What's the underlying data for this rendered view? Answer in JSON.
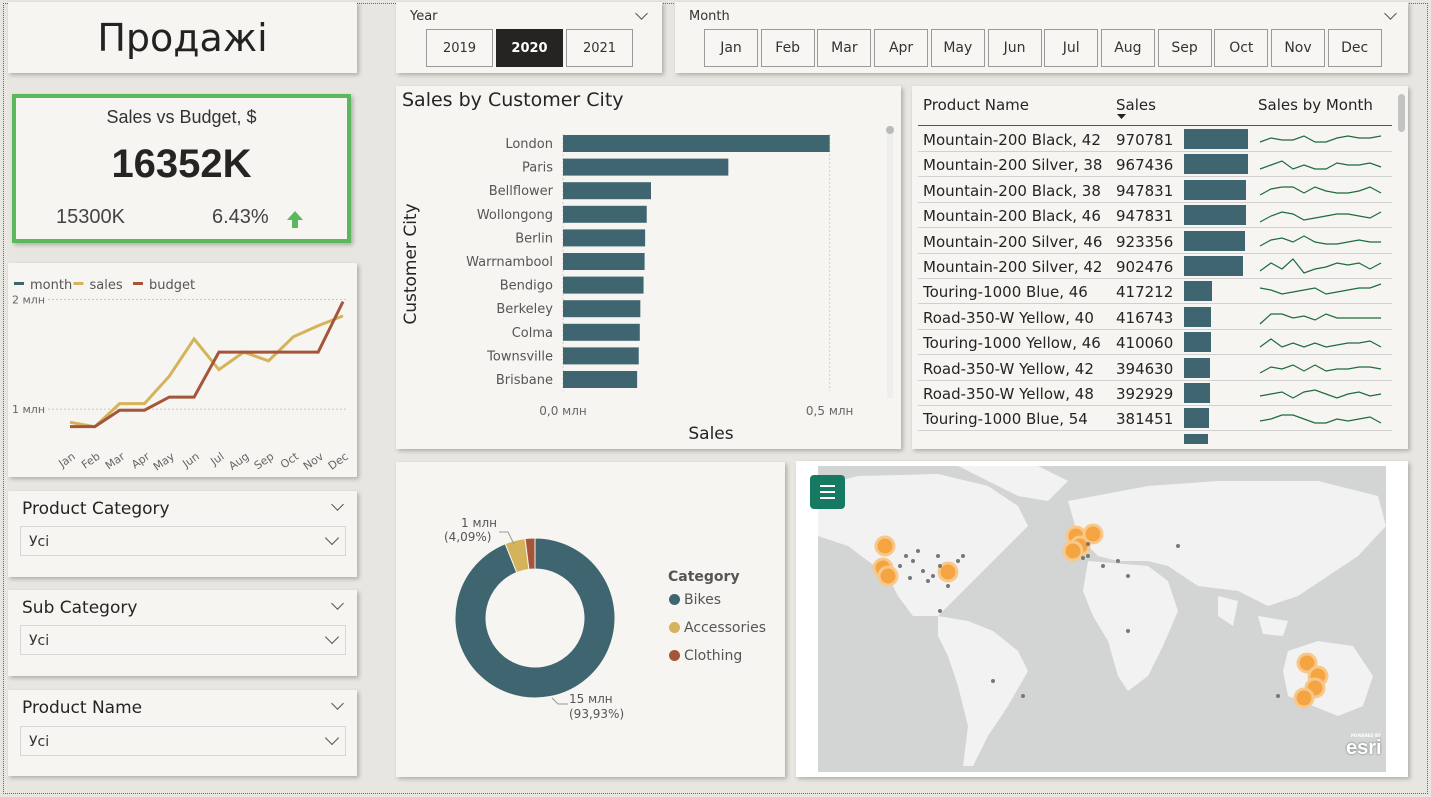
{
  "page": {
    "title": "Продажі"
  },
  "year_slicer": {
    "label": "Year",
    "options": [
      "2019",
      "2020",
      "2021"
    ],
    "selected": "2020"
  },
  "month_slicer": {
    "label": "Month",
    "options": [
      "Jan",
      "Feb",
      "Mar",
      "Apr",
      "May",
      "Jun",
      "Jul",
      "Aug",
      "Sep",
      "Oct",
      "Nov",
      "Dec"
    ]
  },
  "kpi": {
    "title": "Sales vs Budget, $",
    "value": "16352K",
    "budget": "15300K",
    "percent": "6.43%",
    "trend": "up",
    "color": "#5cb85c"
  },
  "line_chart": {
    "legend": [
      "month",
      "sales",
      "budget"
    ],
    "y_ticks": [
      "2 млн",
      "1 млн"
    ],
    "chart_data": {
      "type": "line",
      "categories": [
        "Jan",
        "Feb",
        "Mar",
        "Apr",
        "May",
        "Jun",
        "Jul",
        "Aug",
        "Sep",
        "Oct",
        "Nov",
        "Dec"
      ],
      "series": [
        {
          "name": "sales",
          "color": "#d4b35a",
          "values": [
            0.88,
            0.84,
            1.05,
            1.05,
            1.3,
            1.64,
            1.36,
            1.52,
            1.44,
            1.66,
            1.76,
            1.85
          ]
        },
        {
          "name": "budget",
          "color": "#a4553a",
          "values": [
            0.84,
            0.84,
            0.99,
            0.99,
            1.11,
            1.11,
            1.52,
            1.52,
            1.52,
            1.52,
            1.52,
            1.98
          ]
        }
      ],
      "ylim": [
        0.6,
        2.15
      ]
    }
  },
  "filters": [
    {
      "title": "Product Category",
      "value": "Усі"
    },
    {
      "title": "Sub Category",
      "value": "Усі"
    },
    {
      "title": "Product Name",
      "value": "Усі"
    }
  ],
  "city_chart": {
    "title": "Sales by Customer City",
    "chart_data": {
      "type": "bar",
      "orientation": "horizontal",
      "categories": [
        "London",
        "Paris",
        "Bellflower",
        "Wollongong",
        "Berlin",
        "Warrnambool",
        "Bendigo",
        "Berkeley",
        "Colma",
        "Townsville",
        "Brisbane"
      ],
      "values": [
        0.5,
        0.31,
        0.165,
        0.157,
        0.154,
        0.153,
        0.151,
        0.145,
        0.144,
        0.142,
        0.139
      ],
      "xlabel": "Sales",
      "ylabel": "Customer City",
      "x_ticks": [
        "0,0 млн",
        "0,5 млн"
      ],
      "xlim": [
        0,
        0.6
      ],
      "color": "#3f6670"
    }
  },
  "product_table": {
    "headers": {
      "name": "Product Name",
      "sales": "Sales",
      "spark": "Sales by Month"
    },
    "rows": [
      {
        "name": "Mountain-200 Black, 42",
        "sales": "970781",
        "value": 970781
      },
      {
        "name": "Mountain-200 Silver, 38",
        "sales": "967436",
        "value": 967436
      },
      {
        "name": "Mountain-200 Black, 38",
        "sales": "947831",
        "value": 947831
      },
      {
        "name": "Mountain-200 Black, 46",
        "sales": "947831",
        "value": 947831
      },
      {
        "name": "Mountain-200 Silver, 46",
        "sales": "923356",
        "value": 923356
      },
      {
        "name": "Mountain-200 Silver, 42",
        "sales": "902476",
        "value": 902476
      },
      {
        "name": "Touring-1000 Blue, 46",
        "sales": "417212",
        "value": 417212
      },
      {
        "name": "Road-350-W Yellow, 40",
        "sales": "416743",
        "value": 416743
      },
      {
        "name": "Touring-1000 Yellow, 46",
        "sales": "410060",
        "value": 410060
      },
      {
        "name": "Road-350-W Yellow, 42",
        "sales": "394630",
        "value": 394630
      },
      {
        "name": "Road-350-W Yellow, 48",
        "sales": "392929",
        "value": 392929
      },
      {
        "name": "Touring-1000 Blue, 54",
        "sales": "381451",
        "value": 381451
      }
    ]
  },
  "donut": {
    "legend_title": "Category",
    "label_small_value": "1 млн",
    "label_small_pct": "(4,09%)",
    "label_big_value": "15 млн",
    "label_big_pct": "(93,93%)",
    "chart_data": {
      "type": "pie",
      "categories": [
        "Bikes",
        "Accessories",
        "Clothing"
      ],
      "values": [
        93.93,
        4.09,
        1.98
      ],
      "colors": [
        "#3f6670",
        "#d4b35a",
        "#a4553a"
      ]
    }
  },
  "map": {
    "brand": "esri",
    "powered": "POWERED BY",
    "menu_icon": "hamburger-icon",
    "point_color": "#f5a442"
  }
}
